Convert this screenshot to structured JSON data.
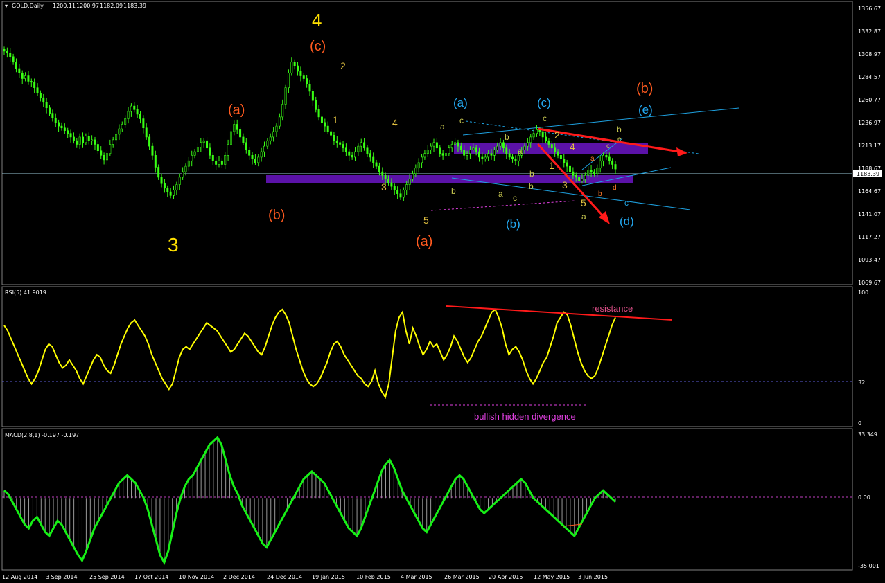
{
  "chart_data": [
    {
      "type": "candlestick",
      "panel": "price",
      "symbol_label": "GOLD,Daily",
      "ohlc": [
        "1200.11",
        "1200.97",
        "1182.09",
        "1183.39"
      ],
      "current_price": "1183.39",
      "y_ticks": [
        "1356.67",
        "1332.87",
        "1308.97",
        "1284.57",
        "1260.77",
        "1236.97",
        "1213.17",
        "1188.67",
        "1164.67",
        "1141.07",
        "1117.27",
        "1093.47",
        "1069.67"
      ],
      "ylim": [
        1058,
        1365
      ],
      "close_series": [
        1312,
        1310,
        1306,
        1300,
        1293,
        1288,
        1282,
        1285,
        1279,
        1278,
        1272,
        1266,
        1261,
        1256,
        1250,
        1244,
        1239,
        1234,
        1230,
        1228,
        1225,
        1222,
        1218,
        1214,
        1210,
        1218,
        1212,
        1219,
        1214,
        1215,
        1210,
        1203,
        1198,
        1193,
        1200,
        1210,
        1215,
        1221,
        1227,
        1232,
        1238,
        1246,
        1252,
        1248,
        1243,
        1238,
        1228,
        1218,
        1208,
        1198,
        1185,
        1174,
        1167,
        1162,
        1158,
        1154,
        1160,
        1166,
        1174,
        1180,
        1186,
        1192,
        1198,
        1202,
        1207,
        1212,
        1214,
        1206,
        1198,
        1192,
        1188,
        1192,
        1188,
        1198,
        1210,
        1224,
        1232,
        1226,
        1218,
        1212,
        1204,
        1198,
        1194,
        1190,
        1196,
        1202,
        1208,
        1214,
        1218,
        1224,
        1230,
        1240,
        1254,
        1272,
        1288,
        1300,
        1296,
        1290,
        1285,
        1282,
        1276,
        1268,
        1258,
        1248,
        1240,
        1234,
        1230,
        1224,
        1220,
        1214,
        1212,
        1210,
        1206,
        1202,
        1198,
        1196,
        1202,
        1208,
        1212,
        1206,
        1200,
        1196,
        1190,
        1186,
        1180,
        1176,
        1172,
        1168,
        1164,
        1160,
        1156,
        1152,
        1160,
        1166,
        1172,
        1178,
        1184,
        1190,
        1196,
        1200,
        1204,
        1208,
        1212,
        1206,
        1200,
        1198,
        1200,
        1206,
        1210,
        1212,
        1208,
        1204,
        1198,
        1200,
        1204,
        1206,
        1202,
        1196,
        1194,
        1196,
        1200,
        1198,
        1204,
        1208,
        1212,
        1206,
        1200,
        1196,
        1194,
        1192,
        1198,
        1204,
        1208,
        1212,
        1218,
        1222,
        1226,
        1224,
        1218,
        1214,
        1210,
        1206,
        1202,
        1198,
        1194,
        1190,
        1186,
        1180,
        1176,
        1174,
        1170,
        1172,
        1176,
        1182,
        1180,
        1178,
        1184,
        1192,
        1198,
        1196,
        1192,
        1188,
        1183
      ],
      "wave_labels": [
        "4",
        "(c)",
        "2",
        "1",
        "(a)",
        "(b)",
        "3",
        "4",
        "3",
        "5",
        "(a)",
        "a",
        "c",
        "b",
        "(a)",
        "b",
        "a",
        "c",
        "(b)",
        "b",
        "a",
        "b",
        "c",
        "2",
        "4",
        "1",
        "3",
        "5",
        "a",
        "a",
        "b",
        "c",
        "b",
        "e",
        "d",
        "(d)",
        "(b)",
        "(e)",
        "c"
      ],
      "colors": {
        "candles": "#39ff14",
        "zones": "#5b12a8",
        "channel": "#1ea1e0",
        "arrows": "#ff1a1a",
        "big_wave": "#ffe000",
        "orange_wave": "#ff5a1f",
        "blue_wave": "#23a9f2",
        "small_wave": "#c8c850"
      }
    },
    {
      "type": "line",
      "panel": "rsi",
      "title": "RSI(5) 41.9019",
      "y_ticks": [
        "100",
        "32",
        "0"
      ],
      "ylim": [
        0,
        100
      ],
      "level": 32,
      "values": [
        74,
        70,
        64,
        58,
        52,
        46,
        40,
        34,
        30,
        34,
        40,
        48,
        56,
        60,
        58,
        52,
        46,
        42,
        44,
        48,
        44,
        40,
        34,
        30,
        36,
        42,
        48,
        52,
        50,
        44,
        40,
        38,
        44,
        52,
        60,
        66,
        72,
        76,
        78,
        74,
        70,
        66,
        60,
        52,
        46,
        40,
        34,
        30,
        26,
        30,
        40,
        50,
        56,
        58,
        56,
        60,
        64,
        68,
        72,
        76,
        74,
        72,
        70,
        66,
        62,
        58,
        54,
        56,
        60,
        64,
        68,
        66,
        62,
        58,
        54,
        52,
        58,
        66,
        74,
        80,
        84,
        86,
        82,
        76,
        66,
        56,
        48,
        40,
        34,
        30,
        28,
        30,
        34,
        40,
        46,
        54,
        60,
        62,
        58,
        52,
        48,
        44,
        40,
        36,
        34,
        30,
        28,
        32,
        40,
        30,
        24,
        20,
        30,
        50,
        70,
        80,
        84,
        70,
        60,
        72,
        66,
        58,
        52,
        56,
        62,
        58,
        60,
        54,
        48,
        52,
        58,
        66,
        62,
        56,
        50,
        46,
        50,
        56,
        62,
        66,
        72,
        78,
        84,
        86,
        80,
        72,
        60,
        52,
        56,
        58,
        54,
        48,
        40,
        34,
        30,
        34,
        40,
        46,
        50,
        58,
        66,
        76,
        80,
        84,
        82,
        74,
        64,
        54,
        46,
        40,
        36,
        34,
        36,
        42,
        50,
        58,
        66,
        74,
        80
      ],
      "annotations": [
        "resistance",
        "bullish hidden divergence"
      ],
      "colors": {
        "line": "#ffff00",
        "level": "#5c5cd6",
        "resistance": "#ff1a1a",
        "divergence": "#e040e0",
        "resistance_text": "#e0508a",
        "divergence_text": "#e040e0"
      }
    },
    {
      "type": "bar+line",
      "panel": "macd",
      "title": "MACD(2,8,1) -0.197 -0.197",
      "y_ticks": [
        "33.349",
        "0.00",
        "-35.001"
      ],
      "ylim": [
        -35.001,
        33.349
      ],
      "values": [
        4,
        2,
        -2,
        -6,
        -10,
        -14,
        -16,
        -12,
        -10,
        -14,
        -18,
        -20,
        -16,
        -12,
        -14,
        -18,
        -22,
        -26,
        -30,
        -33,
        -28,
        -22,
        -16,
        -12,
        -8,
        -4,
        0,
        4,
        8,
        10,
        12,
        10,
        8,
        4,
        0,
        -6,
        -14,
        -22,
        -30,
        -34,
        -28,
        -18,
        -8,
        0,
        6,
        10,
        12,
        16,
        20,
        24,
        28,
        30,
        32,
        28,
        20,
        12,
        6,
        2,
        -4,
        -8,
        -12,
        -16,
        -20,
        -24,
        -26,
        -22,
        -18,
        -14,
        -10,
        -6,
        -2,
        2,
        6,
        10,
        12,
        14,
        12,
        10,
        8,
        4,
        0,
        -4,
        -8,
        -12,
        -16,
        -18,
        -20,
        -16,
        -10,
        -4,
        2,
        8,
        14,
        18,
        20,
        16,
        10,
        4,
        0,
        -4,
        -8,
        -12,
        -16,
        -18,
        -14,
        -10,
        -6,
        -2,
        2,
        6,
        10,
        12,
        10,
        6,
        2,
        -2,
        -6,
        -8,
        -6,
        -4,
        -2,
        0,
        2,
        4,
        6,
        8,
        10,
        8,
        4,
        0,
        -2,
        -4,
        -6,
        -8,
        -10,
        -12,
        -14,
        -16,
        -18,
        -20,
        -16,
        -12,
        -8,
        -4,
        0,
        2,
        4,
        2,
        0,
        -2
      ],
      "colors": {
        "line": "#16f016",
        "hist": "#9a9a9a",
        "zero": "#c040c0",
        "divergence": "#ff5a1f"
      }
    }
  ],
  "x_axis": {
    "tick_labels": [
      "12 Aug 2014",
      "3 Sep 2014",
      "25 Sep 2014",
      "17 Oct 2014",
      "10 Nov 2014",
      "2 Dec 2014",
      "24 Dec 2014",
      "19 Jan 2015",
      "10 Feb 2015",
      "4 Mar 2015",
      "26 Mar 2015",
      "20 Apr 2015",
      "12 May 2015",
      "3 Jun 2015"
    ]
  }
}
